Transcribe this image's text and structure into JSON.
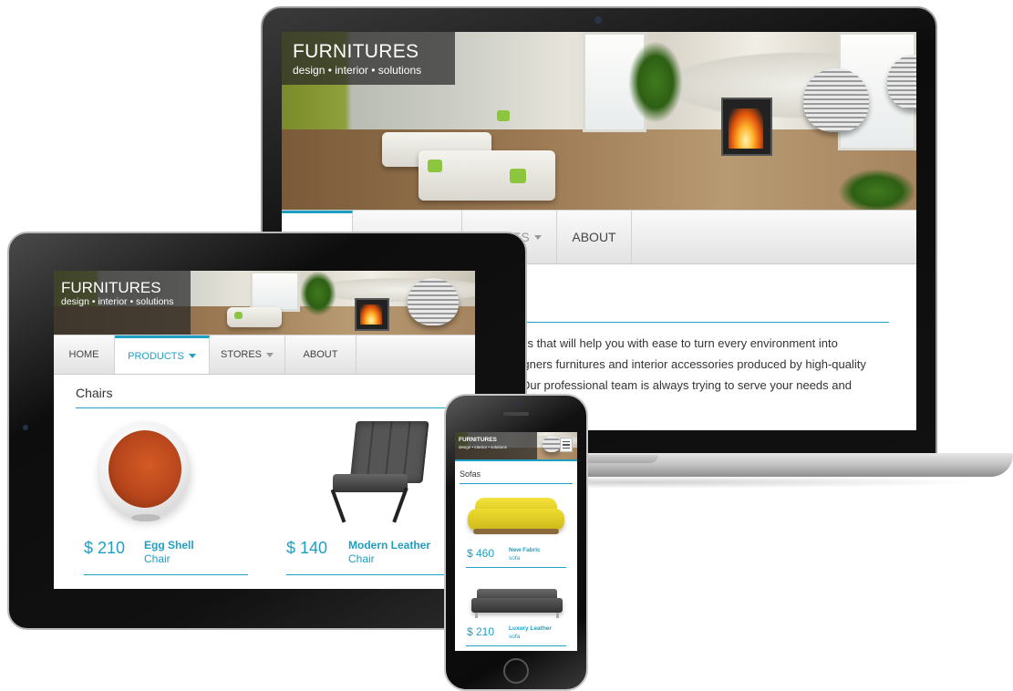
{
  "brand": {
    "title": "FURNITURES",
    "tagline": "design • interior • solutions"
  },
  "laptop": {
    "nav": [
      "",
      "",
      "STORES",
      "ABOUT"
    ],
    "body_lines": [
      "ons that will help you with ease to turn every environment into",
      "signers furnitures and interior accessories produced by high-quality",
      ". Our professional team is always trying to serve your needs and"
    ]
  },
  "tablet": {
    "nav": [
      "HOME",
      "PRODUCTS",
      "STORES",
      "ABOUT"
    ],
    "section_title": "Chairs",
    "products": [
      {
        "price": "$ 210",
        "name": "Egg Shell",
        "type": "Chair"
      },
      {
        "price": "$ 140",
        "name": "Modern Leather",
        "type": "Chair"
      }
    ]
  },
  "phone": {
    "section_title": "Sofas",
    "menu_icon": "hamburger-menu-icon",
    "products": [
      {
        "price": "$ 460",
        "name": "New Fabric",
        "type": "sofa"
      },
      {
        "price": "$ 210",
        "name": "Luxury Leather",
        "type": "sofa"
      }
    ]
  },
  "colors": {
    "accent": "#1e9fc4",
    "brand_overlay": "#282828",
    "sofa_yellow": "#e8d52a",
    "chair_orange": "#b8461c"
  }
}
